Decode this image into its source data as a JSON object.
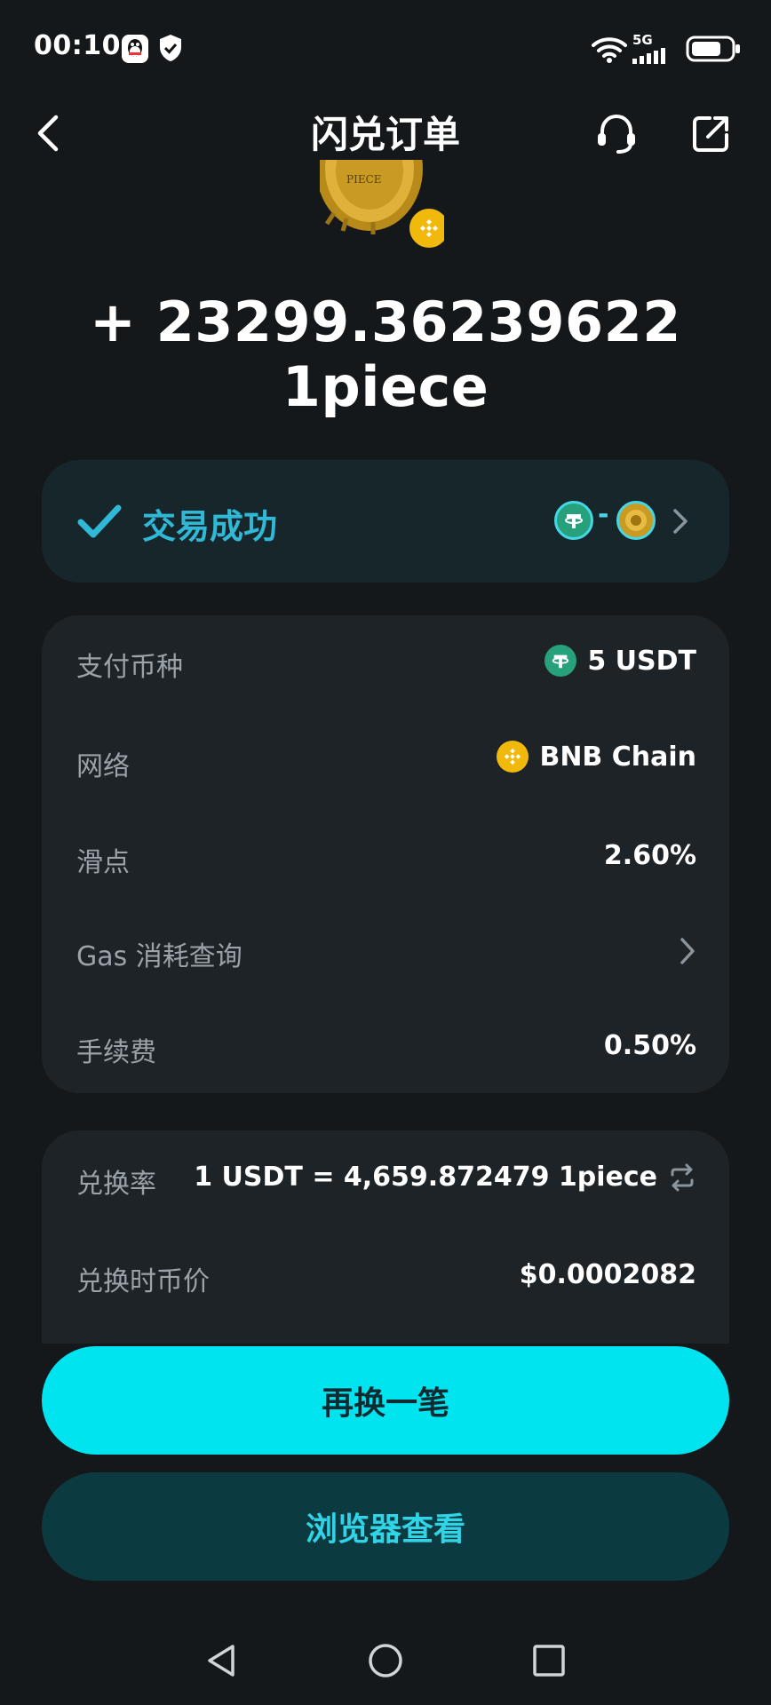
{
  "status_bar": {
    "time": "00:10",
    "network": "5G",
    "icons": [
      "qq-icon",
      "shield-check-icon",
      "wifi-icon",
      "signal-icon",
      "battery-icon"
    ]
  },
  "header": {
    "title": "闪兑订单",
    "icons": [
      "back-arrow-icon",
      "customer-service-icon",
      "share-icon"
    ]
  },
  "hero": {
    "coin_text": "PIECE",
    "amount": "+ 23299.36239622 1piece"
  },
  "status_card": {
    "status": "交易成功",
    "pair_separator": "-",
    "icons": [
      "check-icon",
      "usdt-token-icon",
      "piece-token-icon",
      "chevron-right-icon"
    ]
  },
  "details": [
    {
      "label": "支付币种",
      "value": "5 USDT",
      "icon": "usdt-token-icon"
    },
    {
      "label": "网络",
      "value": "BNB Chain",
      "icon": "bnb-token-icon"
    },
    {
      "label": "滑点",
      "value": "2.60%"
    },
    {
      "label": "Gas 消耗查询",
      "icon": "chevron-right-icon"
    },
    {
      "label": "手续费",
      "value": "0.50%"
    }
  ],
  "rate": {
    "rate_label": "兑换率",
    "rate_value": "1 USDT = 4,659.872479 1piece",
    "price_label": "兑换时币价",
    "price_value": "$0.0002082",
    "icons": [
      "swap-icon"
    ]
  },
  "buttons": {
    "primary": "再换一笔",
    "secondary": "浏览器查看"
  },
  "colors": {
    "background": "#15181b",
    "card": "#1e2327",
    "accent": "#00e4ef",
    "success": "#2fb9d6",
    "usdt": "#26a17b",
    "bnb": "#f0b90b"
  }
}
